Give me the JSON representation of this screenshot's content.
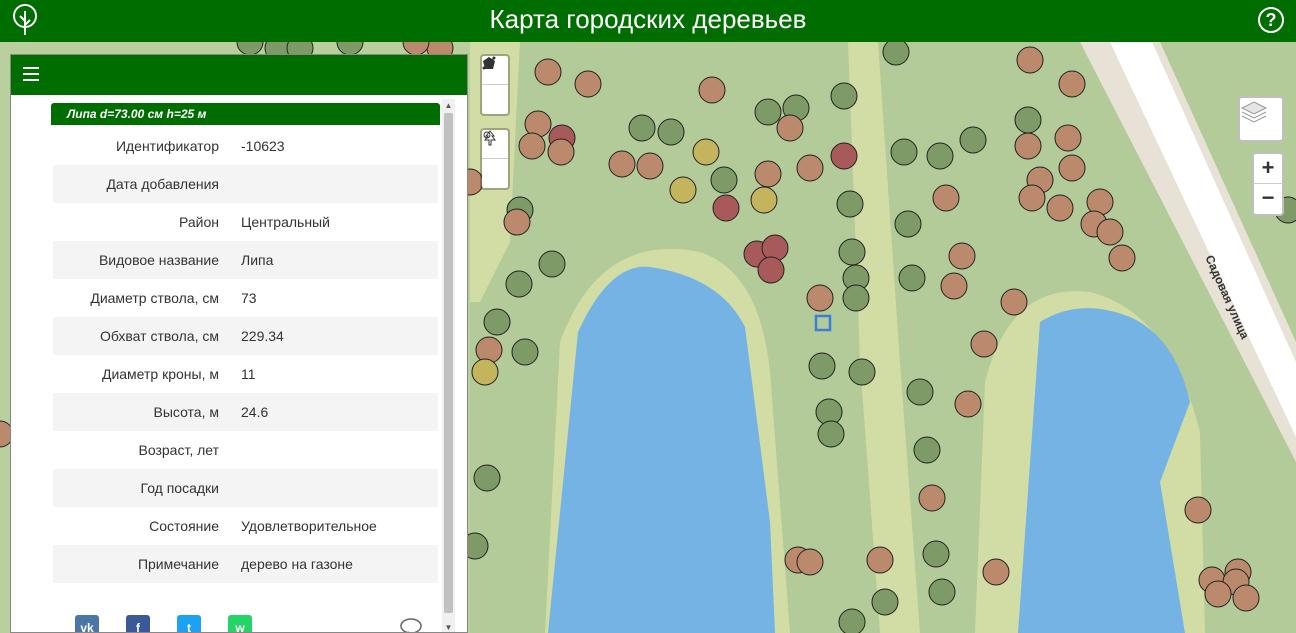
{
  "header": {
    "title": "Карта городских деревьев",
    "help_label": "?"
  },
  "map": {
    "street_label": "Садовая улица"
  },
  "zoom": {
    "in_label": "+",
    "out_label": "−"
  },
  "popup": {
    "title": "Липа d=73.00 см h=25 м",
    "rows": [
      {
        "key": "Идентификатор",
        "value": "-10623"
      },
      {
        "key": "Дата добавления",
        "value": ""
      },
      {
        "key": "Район",
        "value": "Центральный"
      },
      {
        "key": "Видовое название",
        "value": "Липа"
      },
      {
        "key": "Диаметр ствола, см",
        "value": "73"
      },
      {
        "key": "Обхват ствола, см",
        "value": "229.34"
      },
      {
        "key": "Диаметр кроны, м",
        "value": "11"
      },
      {
        "key": "Высота, м",
        "value": "24.6"
      },
      {
        "key": "Возраст, лет",
        "value": ""
      },
      {
        "key": "Год посадки",
        "value": ""
      },
      {
        "key": "Состояние",
        "value": "Удовлетворительное"
      },
      {
        "key": "Примечание",
        "value": "дерево на газоне"
      }
    ]
  },
  "share": [
    {
      "label": "vk",
      "color": "#4a76a8"
    },
    {
      "label": "f",
      "color": "#3b5998"
    },
    {
      "label": "t",
      "color": "#1da1f2"
    },
    {
      "label": "w",
      "color": "#25d366"
    }
  ],
  "colors": {
    "header": "#006d00",
    "water": "#74b3e3",
    "grass": "#b9cf9e"
  }
}
